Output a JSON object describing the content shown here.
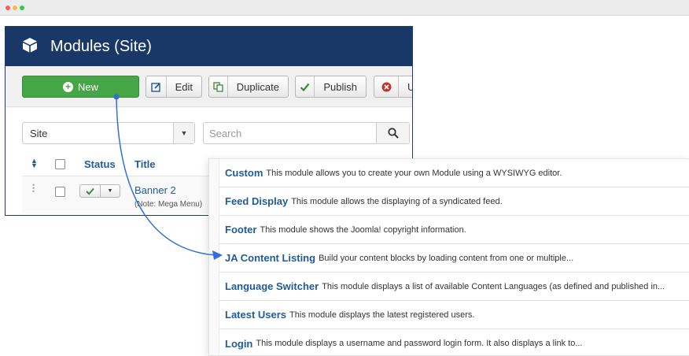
{
  "window": {
    "title": "Modules (Site)"
  },
  "toolbar": {
    "new_label": "New",
    "edit_label": "Edit",
    "duplicate_label": "Duplicate",
    "publish_label": "Publish",
    "unpublish_label": "Ur"
  },
  "filter": {
    "client_value": "Site",
    "search_placeholder": "Search"
  },
  "table": {
    "headers": {
      "status": "Status",
      "title": "Title"
    },
    "rows": [
      {
        "title": "Banner 2",
        "note": "(Note: Mega Menu)",
        "published": true
      }
    ]
  },
  "module_types": [
    {
      "name": "Custom",
      "description": "This module allows you to create your own Module using a WYSIWYG editor."
    },
    {
      "name": "Feed Display",
      "description": "This module allows the displaying of a syndicated feed."
    },
    {
      "name": "Footer",
      "description": "This module shows the Joomla! copyright information."
    },
    {
      "name": "JA Content Listing",
      "description": "Build your content blocks by loading content from one or multiple..."
    },
    {
      "name": "Language Switcher",
      "description": "This module displays a list of available Content Languages (as defined and published in..."
    },
    {
      "name": "Latest Users",
      "description": "This module displays the latest registered users."
    },
    {
      "name": "Login",
      "description": "This module displays a username and password login form. It also displays a link to..."
    }
  ],
  "colors": {
    "header_bg": "#1a3867",
    "new_button": "#46a546",
    "link_blue": "#1f5b99",
    "annotation_arrow": "#2f6fe0"
  },
  "icons": [
    "cube-icon",
    "plus-icon",
    "edit-icon",
    "duplicate-icon",
    "check-icon",
    "x-circle-icon",
    "caret-down-icon",
    "search-icon",
    "sort-icon",
    "drag-handle-icon"
  ]
}
